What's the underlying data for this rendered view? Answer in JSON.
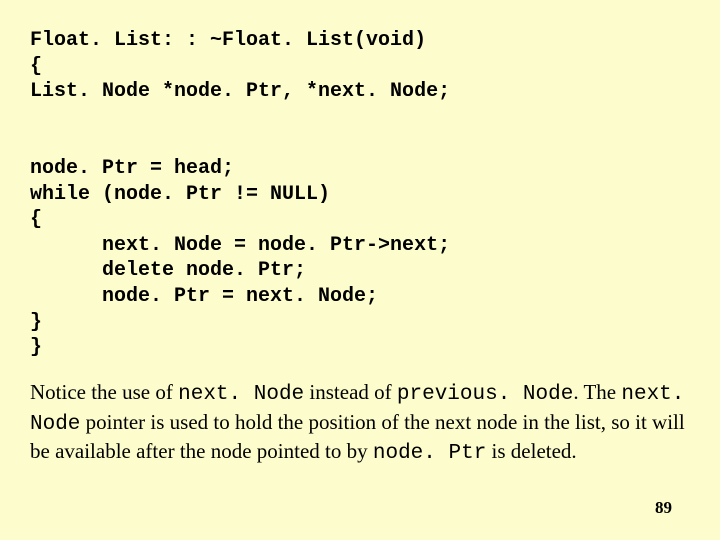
{
  "code": {
    "line1": "Float. List: : ~Float. List(void)",
    "line2": "{",
    "line3": "List. Node *node. Ptr, *next. Node;",
    "blank1": "",
    "blank2": "",
    "line4": "node. Ptr = head;",
    "line5": "while (node. Ptr != NULL)",
    "line6": "{",
    "line7": "      next. Node = node. Ptr->next;",
    "line8": "      delete node. Ptr;",
    "line9": "      node. Ptr = next. Node;",
    "line10": "}",
    "line11": "}"
  },
  "prose": {
    "p1a": "Notice the use of ",
    "p1b": "next. Node",
    "p1c": " instead of ",
    "p1d": "previous. Node",
    "p1e": ". The ",
    "p2a": "next. Node",
    "p2b": " pointer is used to hold the position of the next node in the list, so it will be available after the node pointed to by ",
    "p2c": "node. Ptr",
    "p2d": " is deleted."
  },
  "page_number": "89"
}
